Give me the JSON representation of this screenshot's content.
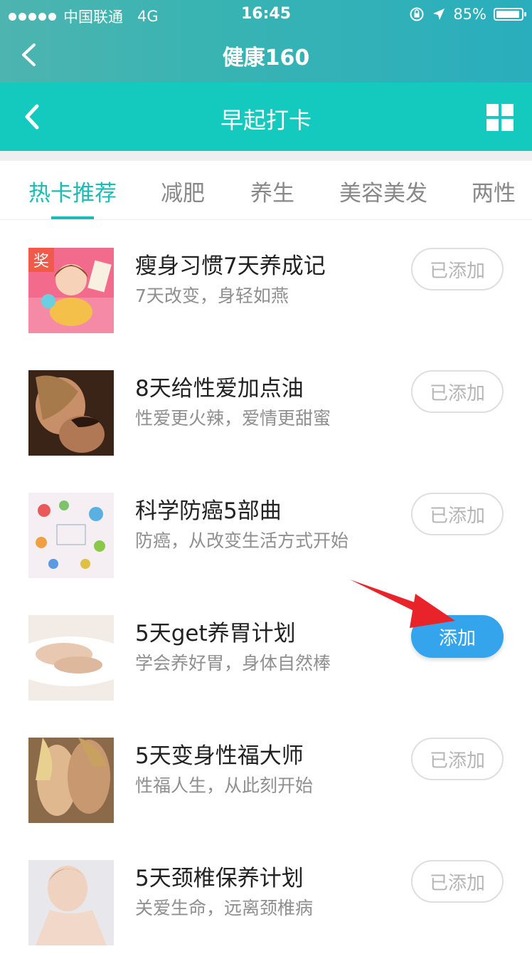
{
  "status_bar": {
    "carrier": "中国联通",
    "network": "4G",
    "time": "16:45",
    "battery": "85%",
    "battery_level": 0.85
  },
  "app": {
    "title": "健康160"
  },
  "page": {
    "title": "早起打卡"
  },
  "tabs": [
    {
      "label": "热卡推荐",
      "active": true
    },
    {
      "label": "减肥",
      "active": false
    },
    {
      "label": "养生",
      "active": false
    },
    {
      "label": "美容美发",
      "active": false
    },
    {
      "label": "两性",
      "active": false
    }
  ],
  "items": [
    {
      "title": "瘦身习惯7天养成记",
      "subtitle": "7天改变，身轻如燕",
      "button": "已添加",
      "badge": "奖"
    },
    {
      "title": "8天给性爱加点油",
      "subtitle": "性爱更火辣，爱情更甜蜜",
      "button": "已添加"
    },
    {
      "title": "科学防癌5部曲",
      "subtitle": "防癌，从改变生活方式开始",
      "button": "已添加"
    },
    {
      "title": "5天get养胃计划",
      "subtitle": "学会养好胃，身体自然棒",
      "button": "添加"
    },
    {
      "title": "5天变身性福大师",
      "subtitle": "性福人生，从此刻开始",
      "button": "已添加"
    },
    {
      "title": "5天颈椎保养计划",
      "subtitle": "关爱生命，远离颈椎病",
      "button": "已添加"
    }
  ],
  "colors": {
    "accent": "#19bdb3",
    "add_button": "#34a5ec",
    "arrow": "#e8242a"
  }
}
